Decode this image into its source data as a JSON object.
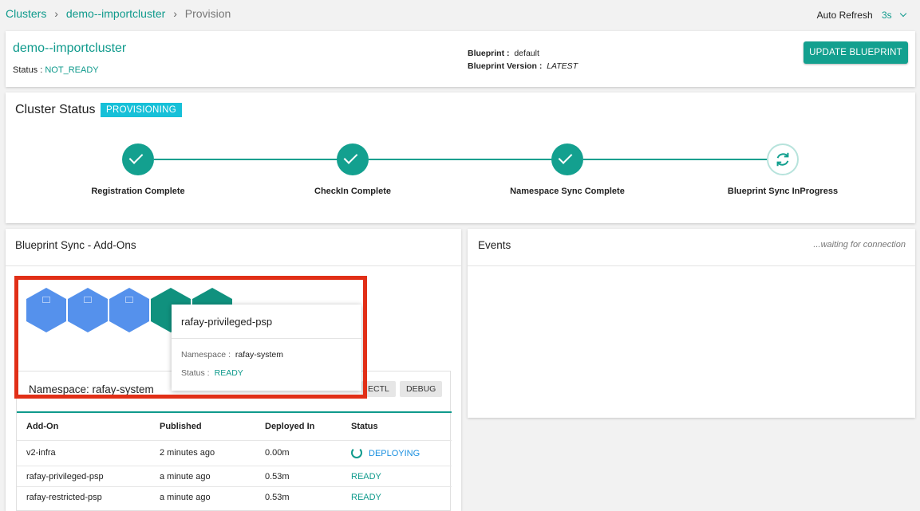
{
  "breadcrumb": {
    "clusters": "Clusters",
    "cluster": "demo--importcluster",
    "current": "Provision",
    "separator": "›"
  },
  "auto_refresh": {
    "label": "Auto Refresh",
    "value": "3s"
  },
  "header": {
    "cluster_name": "demo--importcluster",
    "status_label": "Status :",
    "status_value": "NOT_READY",
    "blueprint_label": "Blueprint :",
    "blueprint_value": "default",
    "blueprint_version_label": "Blueprint Version :",
    "blueprint_version_value": "LATEST",
    "update_button": "UPDATE BLUEPRINT"
  },
  "cluster_status": {
    "title": "Cluster Status",
    "badge": "PROVISIONING",
    "steps": [
      {
        "label": "Registration Complete",
        "state": "complete"
      },
      {
        "label": "CheckIn Complete",
        "state": "complete"
      },
      {
        "label": "Namespace Sync Complete",
        "state": "complete"
      },
      {
        "label": "Blueprint Sync InProgress",
        "state": "in-progress"
      }
    ]
  },
  "blueprint_sync": {
    "title": "Blueprint Sync - Add-Ons",
    "hexes": [
      "blue",
      "blue",
      "blue",
      "green",
      "green"
    ],
    "namespace_title": "Namespace: rafay-system",
    "kubectl_chip": "KUBECTL",
    "kubectl_visible": "ECTL",
    "debug_chip": "DEBUG",
    "columns": [
      "Add-On",
      "Published",
      "Deployed In",
      "Status"
    ],
    "rows": [
      {
        "addon": "v2-infra",
        "published": "2 minutes ago",
        "deployed": "0.00m",
        "status": "DEPLOYING"
      },
      {
        "addon": "rafay-privileged-psp",
        "published": "a minute ago",
        "deployed": "0.53m",
        "status": "READY"
      },
      {
        "addon": "rafay-restricted-psp",
        "published": "a minute ago",
        "deployed": "0.53m",
        "status": "READY"
      }
    ]
  },
  "tooltip": {
    "title": "rafay-privileged-psp",
    "namespace_label": "Namespace :",
    "namespace_value": "rafay-system",
    "status_label": "Status :",
    "status_value": "READY"
  },
  "events": {
    "title": "Events",
    "waiting": "...waiting for connection"
  },
  "colors": {
    "accent": "#0f9a8c",
    "badge": "#17c0d8",
    "hex_blue": "#5591ec",
    "hex_green": "#10917e",
    "highlight": "#e12f17"
  }
}
